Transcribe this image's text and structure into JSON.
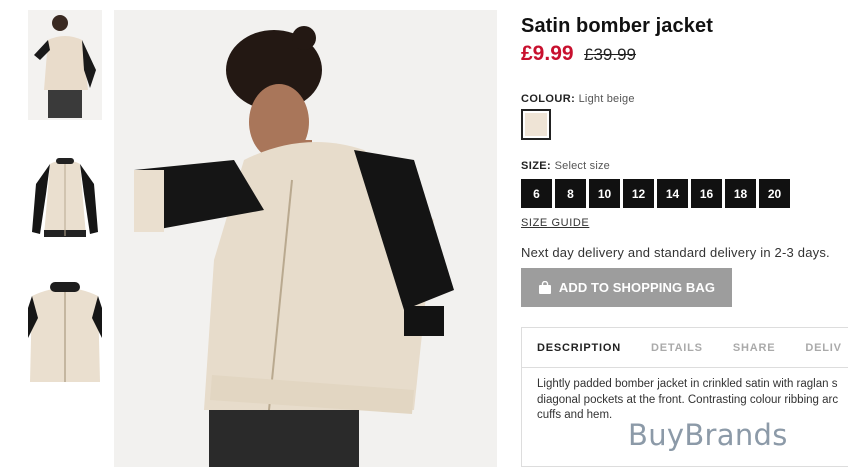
{
  "thumbnails": [
    {
      "alt": "model-front"
    },
    {
      "alt": "jacket-front"
    },
    {
      "alt": "jacket-detail"
    }
  ],
  "product": {
    "title": "Satin bomber jacket",
    "price_now": "£9.99",
    "price_was": "£39.99",
    "colour_label": "COLOUR:",
    "colour_value": "Light beige",
    "swatch_color": "#efe4d6",
    "size_label": "SIZE:",
    "size_value": "Select size",
    "sizes": [
      "6",
      "8",
      "10",
      "12",
      "14",
      "16",
      "18",
      "20"
    ],
    "size_guide": "SIZE GUIDE",
    "delivery": "Next day delivery and standard delivery in 2-3 days.",
    "add_to_bag": "ADD TO SHOPPING BAG"
  },
  "tabs": [
    {
      "label": "DESCRIPTION",
      "active": true
    },
    {
      "label": "DETAILS",
      "active": false
    },
    {
      "label": "SHARE",
      "active": false
    },
    {
      "label": "DELIV",
      "active": false
    }
  ],
  "description_lines": [
    "Lightly padded bomber jacket in crinkled satin with raglan s",
    "diagonal pockets at the front. Contrasting colour ribbing arc",
    "cuffs and hem."
  ],
  "watermark": "BuyBrands",
  "colors": {
    "price": "#c8102e",
    "button": "#9d9d9d",
    "size_button": "#111111"
  }
}
